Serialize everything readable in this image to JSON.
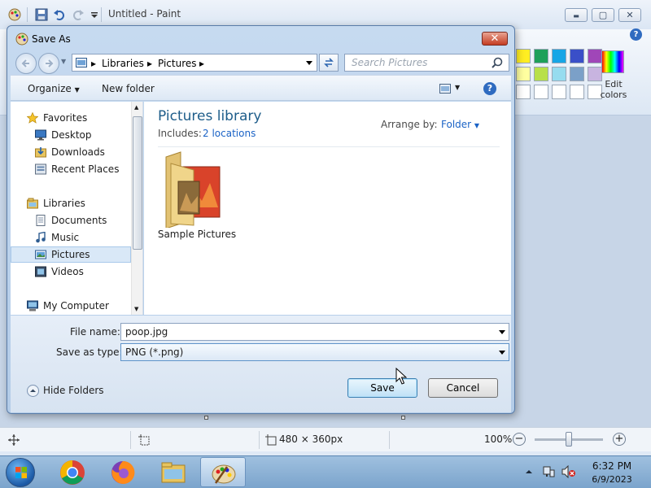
{
  "paint": {
    "title": "Untitled - Paint",
    "window_buttons": {
      "minimize": "▬",
      "maximize": "▢",
      "close": "✕"
    },
    "help": "?",
    "edit_colors": "Edit colors",
    "status": {
      "canvas_size": "480 × 360px",
      "zoom": "100%",
      "zoom_out": "−",
      "zoom_in": "+"
    },
    "palette": [
      "#ffee22",
      "#1ea05a",
      "#16a6e6",
      "#3a4fc8",
      "#a046b8",
      "#ffffa0",
      "#b8e04a",
      "#96dcef",
      "#7ba0c8",
      "#c8b4e0"
    ]
  },
  "dialog": {
    "title": "Save As",
    "close": "✕",
    "breadcrumb": [
      "Libraries",
      "Pictures"
    ],
    "search_placeholder": "Search Pictures",
    "toolbar": {
      "organize": "Organize",
      "new_folder": "New folder",
      "help": "?"
    },
    "nav": {
      "favorites": "Favorites",
      "desktop": "Desktop",
      "downloads": "Downloads",
      "recent_places": "Recent Places",
      "libraries": "Libraries",
      "documents": "Documents",
      "music": "Music",
      "pictures": "Pictures",
      "videos": "Videos",
      "my_computer": "My Computer"
    },
    "library": {
      "title": "Pictures library",
      "includes_label": "Includes:",
      "includes_link": "2 locations",
      "arrange_label": "Arrange by:",
      "arrange_value": "Folder"
    },
    "items": [
      {
        "name": "Sample Pictures"
      }
    ],
    "file_name_label": "File name:",
    "file_name_value": "poop.jpg",
    "save_type_label": "Save as type:",
    "save_type_value": "PNG (*.png)",
    "hide_folders": "Hide Folders",
    "save": "Save",
    "cancel": "Cancel"
  },
  "taskbar": {
    "time": "6:32 PM",
    "date": "6/9/2023"
  },
  "accent_colors": {
    "link": "#1b63c6",
    "library_title": "#1e5d8a",
    "dialog_frame": "#b3cce8"
  }
}
